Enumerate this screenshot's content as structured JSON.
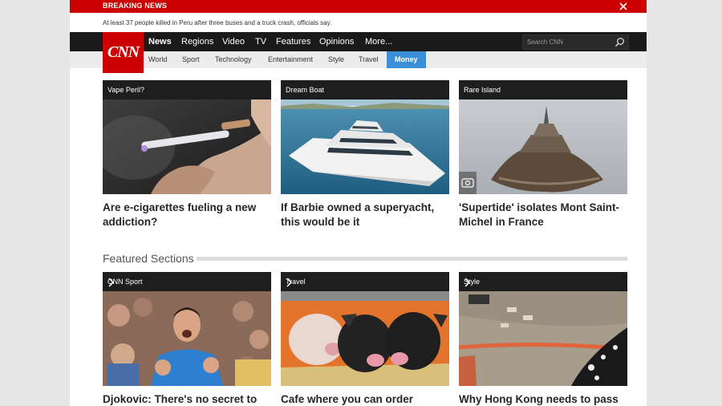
{
  "breaking": {
    "label": "BREAKING NEWS",
    "headline": "At least 37 people killed in Peru after three buses and a truck crash, officials say."
  },
  "logo": {
    "text": "CNN"
  },
  "nav": {
    "items": [
      {
        "label": "News"
      },
      {
        "label": "Regions"
      },
      {
        "label": "Video"
      },
      {
        "label": "TV"
      },
      {
        "label": "Features"
      },
      {
        "label": "Opinions"
      },
      {
        "label": "More..."
      }
    ],
    "search_placeholder": "Search CNN"
  },
  "subnav": {
    "items": [
      {
        "label": "World"
      },
      {
        "label": "Sport"
      },
      {
        "label": "Technology"
      },
      {
        "label": "Entertainment"
      },
      {
        "label": "Style"
      },
      {
        "label": "Travel"
      },
      {
        "label": "Money"
      }
    ]
  },
  "top_cards": [
    {
      "label": "Vape Peril?",
      "title": "Are e-cigarettes fueling a new addiction?"
    },
    {
      "label": "Dream Boat",
      "title": "If Barbie owned a superyacht, this would be it"
    },
    {
      "label": "Rare Island",
      "title": "'Supertide' isolates Mont Saint-Michel in France"
    }
  ],
  "featured": {
    "heading": "Featured Sections",
    "cards": [
      {
        "label": "CNN Sport",
        "title": "Djokovic: There's no secret to"
      },
      {
        "label": "Travel",
        "title": "Cafe where you can order"
      },
      {
        "label": "Style",
        "title": "Why Hong Kong needs to pass"
      }
    ]
  },
  "colors": {
    "brand_red": "#cc0000",
    "nav_black": "#1a1a1a",
    "active_blue": "#3a8fd6"
  }
}
